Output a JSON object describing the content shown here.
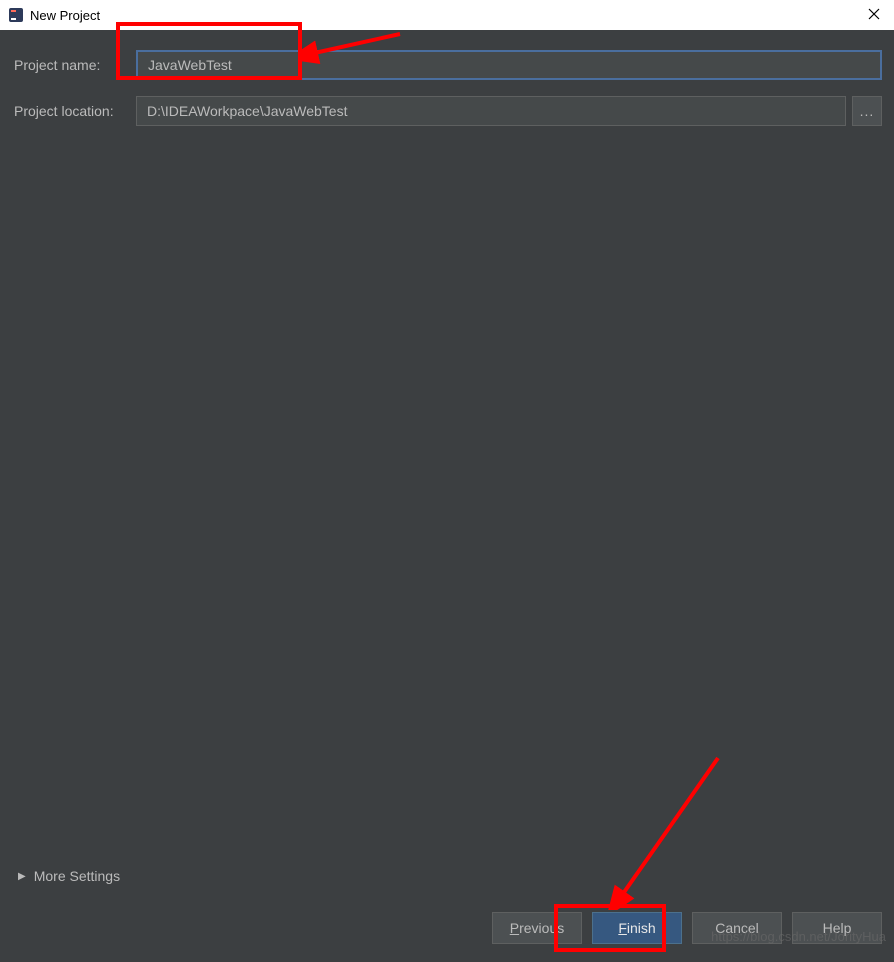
{
  "titlebar": {
    "title": "New Project",
    "close_label": "×"
  },
  "form": {
    "project_name_label": "Project name:",
    "project_name_value": "JavaWebTest",
    "project_location_label": "Project location:",
    "project_location_value": "D:\\IDEAWorkpace\\JavaWebTest",
    "browse_label": "..."
  },
  "more_settings": {
    "label": "More Settings"
  },
  "buttons": {
    "previous": "Previous",
    "finish": "Finish",
    "cancel": "Cancel",
    "help": "Help"
  },
  "watermark": "https://blog.csdn.net/JorityHua"
}
